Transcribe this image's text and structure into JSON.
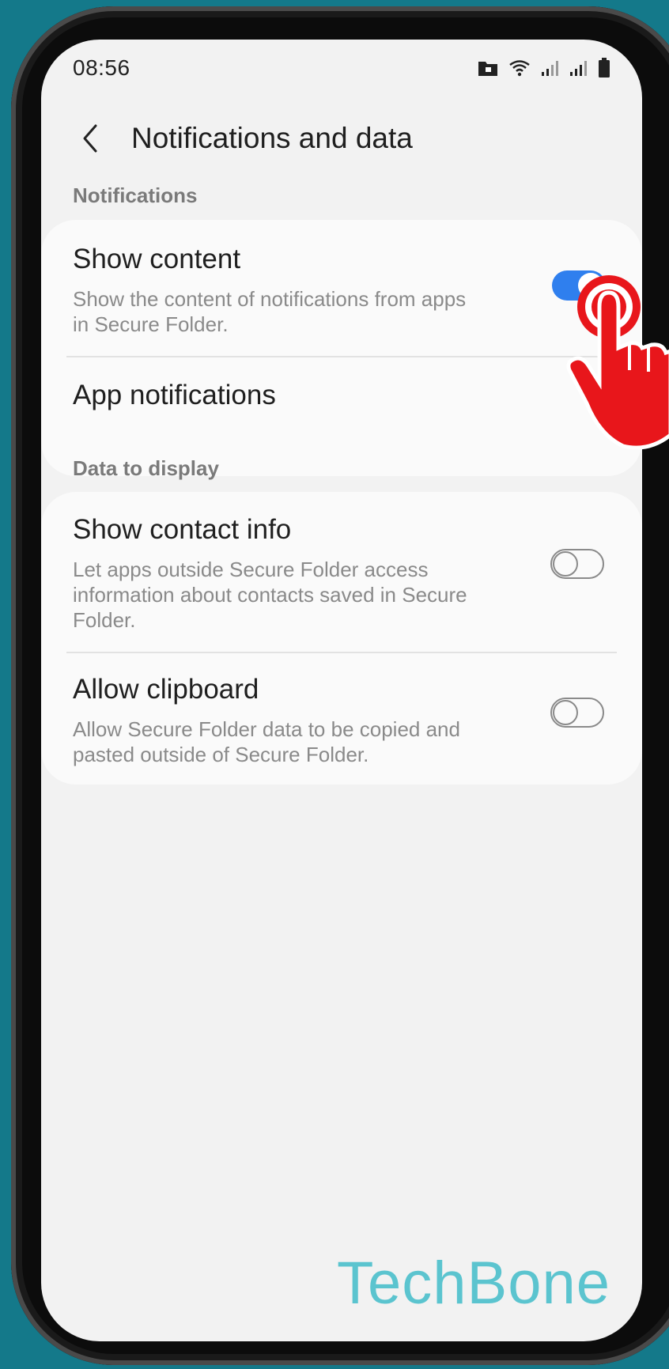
{
  "status": {
    "time": "08:56"
  },
  "header": {
    "title": "Notifications and data"
  },
  "sections": {
    "notifications": {
      "label": "Notifications",
      "show_content": {
        "title": "Show content",
        "subtitle": "Show the content of notifications from apps in Secure Folder.",
        "enabled": true
      },
      "app_notifications": {
        "title": "App notifications"
      }
    },
    "data_to_display": {
      "label": "Data to display",
      "show_contact_info": {
        "title": "Show contact info",
        "subtitle": "Let apps outside Secure Folder access information about contacts saved in Secure Folder.",
        "enabled": false
      },
      "allow_clipboard": {
        "title": "Allow clipboard",
        "subtitle": "Allow Secure Folder data to be copied and pasted outside of Secure Folder.",
        "enabled": false
      }
    }
  },
  "watermark": "TechBone",
  "colors": {
    "accent": "#2f7fee",
    "background": "#14798a",
    "tap_indicator": "#e8161b",
    "watermark": "#5bc4cf"
  }
}
